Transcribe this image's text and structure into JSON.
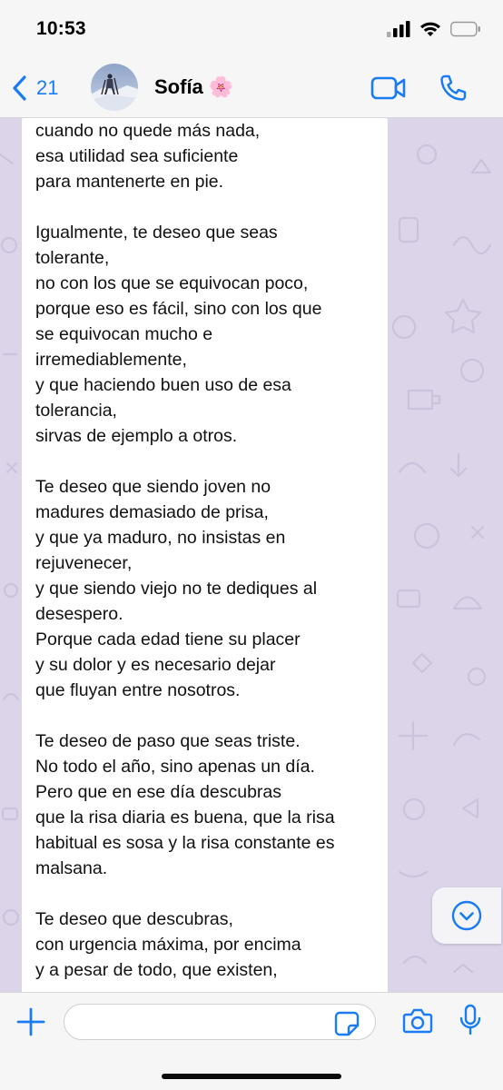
{
  "status_bar": {
    "time": "10:53",
    "icons": [
      "cellular-signal-icon",
      "wifi-icon",
      "battery-icon"
    ]
  },
  "header": {
    "back_count": "21",
    "contact_name": "Sofía 🌸",
    "icons": [
      "back-chevron-icon",
      "video-call-icon",
      "phone-icon"
    ]
  },
  "message": {
    "lines": [
      "cuando no quede más nada,",
      "esa utilidad sea suficiente",
      "para mantenerte en pie.",
      "",
      "Igualmente, te deseo que seas",
      "tolerante,",
      "no con los que se equivocan poco,",
      "porque eso es fácil, sino con los que",
      "se equivocan mucho e",
      "irremediablemente,",
      "y que haciendo buen uso de esa",
      "tolerancia,",
      "sirvas de ejemplo a otros.",
      "",
      "Te deseo que siendo joven no",
      "madures demasiado de prisa,",
      "y que ya maduro, no insistas en",
      "rejuvenecer,",
      "y que siendo viejo no te dediques al",
      "desespero.",
      "Porque cada edad tiene su placer",
      "y su dolor y es necesario dejar",
      "que fluyan entre nosotros.",
      "",
      "Te deseo de paso que seas triste.",
      "No todo el año, sino apenas un día.",
      "Pero que en ese día descubras",
      "que la risa diaria es buena, que la risa",
      "habitual es sosa y la risa constante es",
      "malsana.",
      "",
      "Te deseo que descubras,",
      "con urgencia máxima, por encima",
      "y a pesar de todo, que existen,"
    ]
  },
  "input_bar": {
    "message_value": "",
    "icons": [
      "plus-icon",
      "sticker-icon",
      "camera-icon",
      "microphone-icon"
    ]
  },
  "colors": {
    "accent": "#1a7cf5",
    "chat_background": "#dcd5ea",
    "bar_background": "#f6f6f6",
    "bubble_background": "#ffffff"
  }
}
